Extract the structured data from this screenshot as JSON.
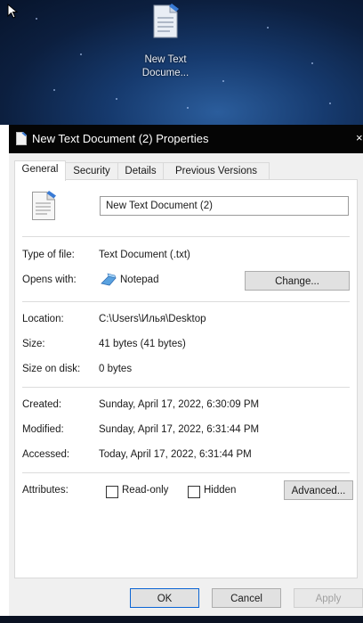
{
  "desktop": {
    "icon_label_line1": "New Text",
    "icon_label_line2": "Docume..."
  },
  "dialog": {
    "title": "New Text Document (2) Properties",
    "tabs": [
      {
        "label": "General"
      },
      {
        "label": "Security"
      },
      {
        "label": "Details"
      },
      {
        "label": "Previous Versions"
      }
    ],
    "file_name": "New Text Document (2)",
    "type_of_file": {
      "label": "Type of file:",
      "value": "Text Document (.txt)"
    },
    "opens_with": {
      "label": "Opens with:",
      "value": "Notepad",
      "button": "Change..."
    },
    "location": {
      "label": "Location:",
      "value": "C:\\Users\\Илья\\Desktop"
    },
    "size": {
      "label": "Size:",
      "value": "41 bytes (41 bytes)"
    },
    "size_on_disk": {
      "label": "Size on disk:",
      "value": "0 bytes"
    },
    "created": {
      "label": "Created:",
      "value": "Sunday, April 17, 2022, 6:30:09 PM"
    },
    "modified": {
      "label": "Modified:",
      "value": "Sunday, April 17, 2022, 6:31:44 PM"
    },
    "accessed": {
      "label": "Accessed:",
      "value": "Today, April 17, 2022, 6:31:44 PM"
    },
    "attributes": {
      "label": "Attributes:",
      "read_only": "Read-only",
      "read_only_checked": false,
      "hidden": "Hidden",
      "hidden_checked": false,
      "advanced_button": "Advanced..."
    },
    "buttons": {
      "ok": "OK",
      "cancel": "Cancel",
      "apply": "Apply"
    }
  },
  "colors": {
    "titlebar": "#050505",
    "focus_accent": "#0a64d4"
  }
}
